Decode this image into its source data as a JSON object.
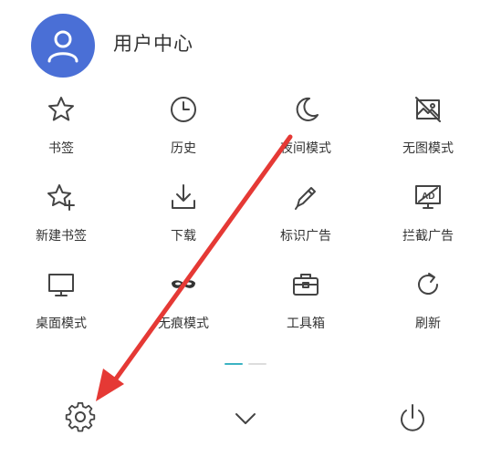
{
  "header": {
    "title": "用户中心",
    "avatar_icon": "user-avatar-icon",
    "avatar_color": "#4a6fd6"
  },
  "menu": {
    "items": [
      {
        "label": "书签",
        "icon": "star-icon"
      },
      {
        "label": "历史",
        "icon": "clock-icon"
      },
      {
        "label": "夜间模式",
        "icon": "moon-icon"
      },
      {
        "label": "无图模式",
        "icon": "no-image-icon"
      },
      {
        "label": "新建书签",
        "icon": "star-plus-icon"
      },
      {
        "label": "下载",
        "icon": "download-icon"
      },
      {
        "label": "标识广告",
        "icon": "pen-icon"
      },
      {
        "label": "拦截广告",
        "icon": "ad-block-icon"
      },
      {
        "label": "桌面模式",
        "icon": "monitor-icon"
      },
      {
        "label": "无痕模式",
        "icon": "mask-icon"
      },
      {
        "label": "工具箱",
        "icon": "toolbox-icon"
      },
      {
        "label": "刷新",
        "icon": "refresh-icon"
      }
    ]
  },
  "pager": {
    "active_color": "#3bb3c3",
    "inactive_color": "#dddddd"
  },
  "bottom_bar": {
    "settings_icon": "gear-icon",
    "collapse_icon": "chevron-down-icon",
    "power_icon": "power-icon"
  },
  "annotation": {
    "arrow_color": "#e53935"
  }
}
